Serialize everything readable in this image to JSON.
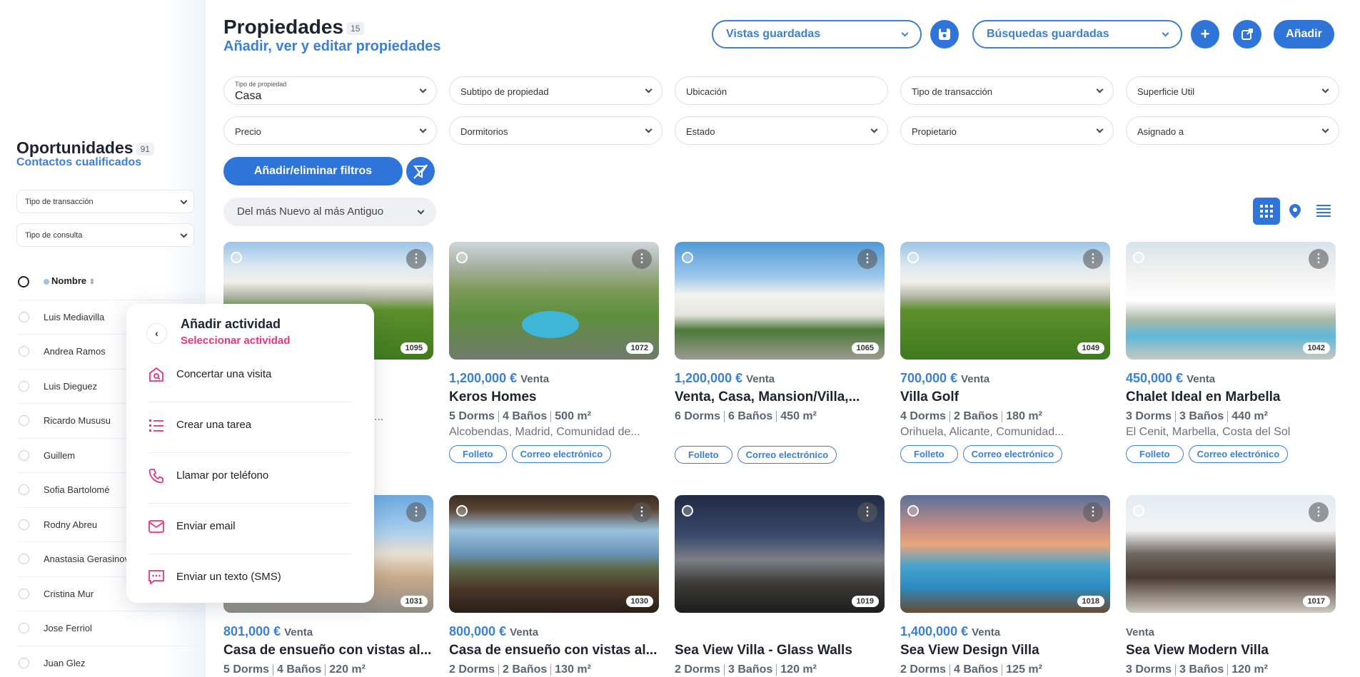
{
  "sidebar": {
    "title": "Oportunidades",
    "count": "91",
    "subtitle": "Contactos cualificados",
    "filters": [
      "Tipo de transacción",
      "Tipo de consulta"
    ],
    "column_header": "Nombre",
    "contacts": [
      "Luis Mediavilla",
      "Andrea Ramos",
      "Luis Dieguez",
      "Ricardo Mususu",
      "Guillem",
      "Sofia Bartolomé",
      "Rodny Abreu",
      "Anastasia Gerasinova",
      "Cristina Mur",
      "Jose Ferriol",
      "Juan Glez"
    ]
  },
  "header": {
    "title": "Propiedades",
    "count": "15",
    "subtitle": "Añadir, ver y editar propiedades",
    "saved_views": "Vistas guardadas",
    "saved_searches": "Búsquedas guardadas",
    "add_label": "Añadir"
  },
  "filters": {
    "property_type_label": "Tipo de propiedad",
    "property_type_value": "Casa",
    "subtype": "Subtipo de propiedad",
    "location_placeholder": "Ubicación",
    "transaction": "Tipo de transacción",
    "area": "Superficie Util",
    "price": "Precio",
    "bedrooms": "Dormitorios",
    "status": "Estado",
    "owner": "Propietario",
    "assigned": "Asignado a",
    "toggle_filters": "Añadir/eliminar filtros",
    "sort": "Del más Nuevo al más Antiguo"
  },
  "card_labels": {
    "brochure": "Folleto",
    "email": "Correo electrónico"
  },
  "properties": [
    {
      "ref": "1095",
      "price": "",
      "op": "",
      "title": "",
      "specs": [
        "",
        "",
        ""
      ],
      "location": "…d...",
      "show_brochure": false
    },
    {
      "ref": "1072",
      "price": "1,200,000 €",
      "op": "Venta",
      "title": "Keros Homes",
      "specs": [
        "5 Dorms",
        "4 Baños",
        "500 m²"
      ],
      "location": "Alcobendas, Madrid, Comunidad de..."
    },
    {
      "ref": "1065",
      "price": "1,200,000 €",
      "op": "Venta",
      "title": "Venta, Casa, Mansion/Villa,...",
      "specs": [
        "6 Dorms",
        "6 Baños",
        "450 m²"
      ],
      "location": ""
    },
    {
      "ref": "1049",
      "price": "700,000 €",
      "op": "Venta",
      "title": "Villa Golf",
      "specs": [
        "4 Dorms",
        "2 Baños",
        "180 m²"
      ],
      "location": "Orihuela, Alicante, Comunidad..."
    },
    {
      "ref": "1042",
      "price": "450,000 €",
      "op": "Venta",
      "title": "Chalet Ideal en Marbella",
      "specs": [
        "3 Dorms",
        "3 Baños",
        "440 m²"
      ],
      "location": "El Cenit, Marbella, Costa del Sol"
    },
    {
      "ref": "1031",
      "price": "801,000 €",
      "op": "Venta",
      "title": "Casa de ensueño con vistas al...",
      "specs": [
        "5 Dorms",
        "4 Baños",
        "220 m²"
      ],
      "location": ""
    },
    {
      "ref": "1030",
      "price": "800,000 €",
      "op": "Venta",
      "title": "Casa de ensueño con vistas al...",
      "specs": [
        "2 Dorms",
        "2 Baños",
        "130 m²"
      ],
      "location": ""
    },
    {
      "ref": "1019",
      "price": "",
      "op": "",
      "title": "Sea View Villa - Glass Walls",
      "specs": [
        "2 Dorms",
        "3 Baños",
        "120 m²"
      ],
      "location": ""
    },
    {
      "ref": "1018",
      "price": "1,400,000 €",
      "op": "Venta",
      "title": "Sea View Design Villa",
      "specs": [
        "2 Dorms",
        "4 Baños",
        "125 m²"
      ],
      "location": ""
    },
    {
      "ref": "1017",
      "price": "",
      "op": "Venta",
      "title": "Sea View Modern Villa",
      "specs": [
        "3 Dorms",
        "3 Baños",
        "120 m²"
      ],
      "location": ""
    }
  ],
  "popup": {
    "title": "Añadir actividad",
    "subtitle": "Seleccionar actividad",
    "items": [
      "Concertar una visita",
      "Crear una tarea",
      "Llamar por teléfono",
      "Enviar email",
      "Enviar un texto (SMS)"
    ]
  },
  "colors": {
    "accent": "#2f74d8",
    "accent_text": "#3b7fd6",
    "pink": "#e8357c"
  },
  "icons": [
    "save-icon",
    "plus-icon",
    "share-icon",
    "filter-off-icon",
    "grid-view-icon",
    "map-pin-icon",
    "list-view-icon",
    "kebab-icon",
    "back-chevron-icon",
    "house-search-icon",
    "task-list-icon",
    "phone-icon",
    "mail-icon",
    "sms-icon"
  ]
}
